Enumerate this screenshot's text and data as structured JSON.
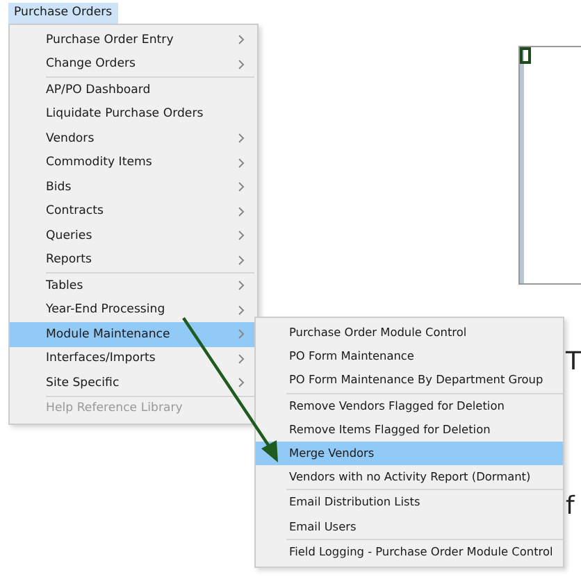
{
  "menu_bar": {
    "title": "Purchase Orders",
    "selected": true
  },
  "menu": {
    "sections": [
      {
        "items": [
          {
            "label": "Purchase Order Entry",
            "has_submenu": true,
            "selected": false,
            "disabled": false
          },
          {
            "label": "Change Orders",
            "has_submenu": true,
            "selected": false,
            "disabled": false
          }
        ]
      },
      {
        "items": [
          {
            "label": "AP/PO Dashboard",
            "has_submenu": false,
            "selected": false,
            "disabled": false
          },
          {
            "label": "Liquidate Purchase Orders",
            "has_submenu": false,
            "selected": false,
            "disabled": false
          },
          {
            "label": "Vendors",
            "has_submenu": true,
            "selected": false,
            "disabled": false
          },
          {
            "label": "Commodity Items",
            "has_submenu": true,
            "selected": false,
            "disabled": false
          },
          {
            "label": "Bids",
            "has_submenu": true,
            "selected": false,
            "disabled": false
          },
          {
            "label": "Contracts",
            "has_submenu": true,
            "selected": false,
            "disabled": false
          },
          {
            "label": "Queries",
            "has_submenu": true,
            "selected": false,
            "disabled": false
          },
          {
            "label": "Reports",
            "has_submenu": true,
            "selected": false,
            "disabled": false
          }
        ]
      },
      {
        "items": [
          {
            "label": "Tables",
            "has_submenu": true,
            "selected": false,
            "disabled": false
          },
          {
            "label": "Year-End Processing",
            "has_submenu": true,
            "selected": false,
            "disabled": false
          },
          {
            "label": "Module Maintenance",
            "has_submenu": true,
            "selected": true,
            "disabled": false
          },
          {
            "label": "Interfaces/Imports",
            "has_submenu": true,
            "selected": false,
            "disabled": false
          },
          {
            "label": "Site Specific",
            "has_submenu": true,
            "selected": false,
            "disabled": false
          }
        ]
      },
      {
        "items": [
          {
            "label": "Help Reference Library",
            "has_submenu": false,
            "selected": false,
            "disabled": true
          }
        ]
      }
    ]
  },
  "submenu": {
    "sections": [
      {
        "items": [
          {
            "label": "Purchase Order Module Control",
            "selected": false
          },
          {
            "label": "PO Form Maintenance",
            "selected": false
          },
          {
            "label": "PO Form Maintenance By Department Group",
            "selected": false
          }
        ]
      },
      {
        "items": [
          {
            "label": "Remove Vendors Flagged for Deletion",
            "selected": false
          },
          {
            "label": "Remove Items Flagged for Deletion",
            "selected": false
          },
          {
            "label": "Merge Vendors",
            "selected": true
          },
          {
            "label": "Vendors with no Activity Report (Dormant)",
            "selected": false
          }
        ]
      },
      {
        "items": [
          {
            "label": "Email Distribution Lists",
            "selected": false
          },
          {
            "label": "Email Users",
            "selected": false
          }
        ]
      },
      {
        "items": [
          {
            "label": "Field Logging - Purchase Order Module Control",
            "selected": false
          }
        ]
      }
    ]
  },
  "background_text": [
    "T",
    "f"
  ]
}
